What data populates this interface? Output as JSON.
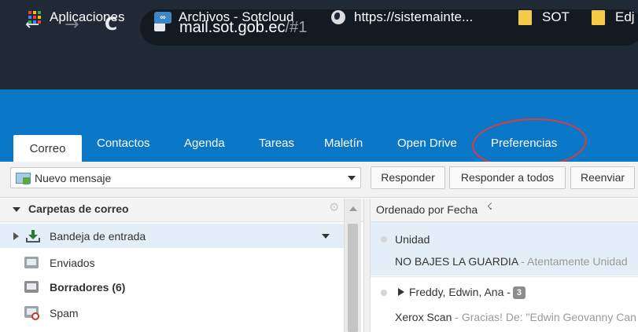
{
  "browser": {
    "url_host": "mail.sot.gob.ec",
    "url_path": "/#1",
    "back_icon": "←",
    "forward_icon": "→",
    "reload_icon": "C"
  },
  "bookmarks": [
    {
      "label": "Aplicaciones",
      "icon": "apps-grid-icon"
    },
    {
      "label": "Archivos - Sotcloud",
      "icon": "nextcloud-icon"
    },
    {
      "label": "https://sistemainte...",
      "icon": "globe-icon"
    },
    {
      "label": "SOT",
      "icon": "bookmark-folder-icon"
    },
    {
      "label": "Edj",
      "icon": "bookmark-folder-icon"
    }
  ],
  "tabs": [
    "Correo",
    "Contactos",
    "Agenda",
    "Tareas",
    "Maletín",
    "Open Drive",
    "Preferencias"
  ],
  "toolbar": {
    "compose_label": "Nuevo mensaje",
    "reply_label": "Responder",
    "reply_all_label": "Responder a todos",
    "forward_label": "Reenviar"
  },
  "folders": {
    "title": "Carpetas de correo",
    "items": [
      {
        "label": "Bandeja de entrada"
      },
      {
        "label": "Enviados"
      },
      {
        "label": "Borradores (6)"
      },
      {
        "label": "Spam"
      }
    ]
  },
  "message_list": {
    "sort_label": "Ordenado por Fecha",
    "messages": [
      {
        "sender": "Unidad",
        "subject": "NO BAJES LA GUARDIA",
        "snippet": " - Atentamente Unidad"
      },
      {
        "sender": "Freddy, Edwin, Ana -",
        "count": "3",
        "subject": "Xerox Scan",
        "snippet": " - Gracias! De: \"Edwin Geovanny Can"
      }
    ]
  },
  "colors": {
    "browser_bg": "#1f2a36",
    "header_blue": "#0a77c7",
    "highlight_circle": "#e23b3b",
    "selected_row": "#e3eef8"
  }
}
